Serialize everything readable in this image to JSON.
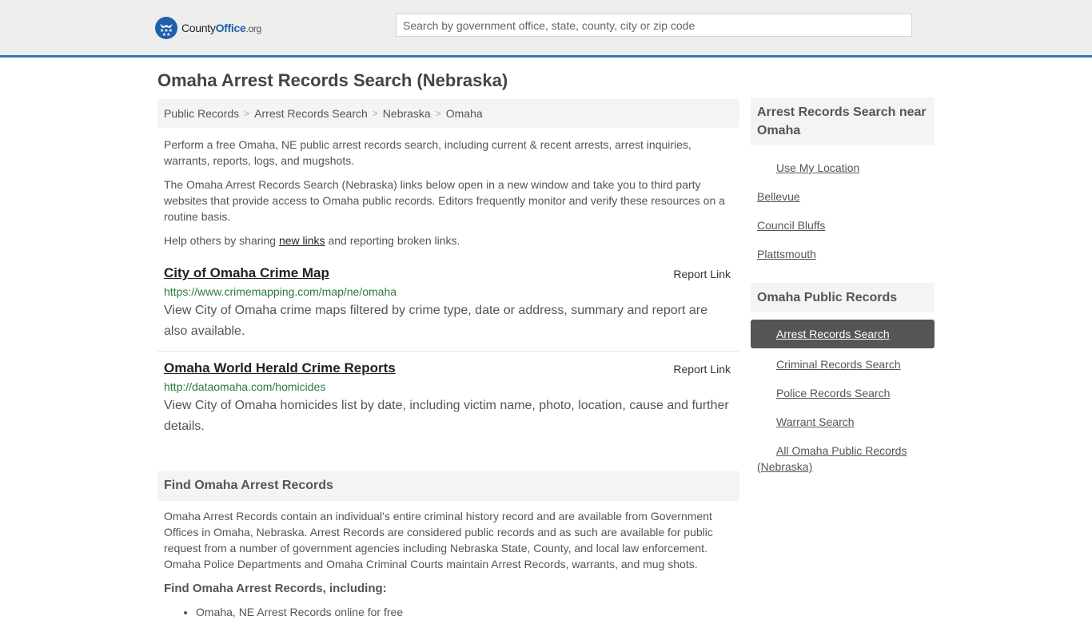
{
  "header": {
    "logo": {
      "name_part1": "County",
      "name_part2": "Office",
      "tld": ".org"
    },
    "search_placeholder": "Search by government office, state, county, city or zip code"
  },
  "page_title": "Omaha Arrest Records Search (Nebraska)",
  "breadcrumb": [
    {
      "label": "Public Records"
    },
    {
      "label": "Arrest Records Search"
    },
    {
      "label": "Nebraska"
    },
    {
      "label": "Omaha"
    }
  ],
  "breadcrumb_separator": ">",
  "intro": {
    "p1": "Perform a free Omaha, NE public arrest records search, including current & recent arrests, arrest inquiries, warrants, reports, logs, and mugshots.",
    "p2": "The Omaha Arrest Records Search (Nebraska) links below open in a new window and take you to third party websites that provide access to Omaha public records. Editors frequently monitor and verify these resources on a routine basis.",
    "p3_before": "Help others by sharing ",
    "p3_link": "new links",
    "p3_after": " and reporting broken links."
  },
  "links": [
    {
      "title": "City of Omaha Crime Map",
      "report_label": "Report Link",
      "url": "https://www.crimemapping.com/map/ne/omaha",
      "description": "View City of Omaha crime maps filtered by crime type, date or address, summary and report are also available."
    },
    {
      "title": "Omaha World Herald Crime Reports",
      "report_label": "Report Link",
      "url": "http://dataomaha.com/homicides",
      "description": "View City of Omaha homicides list by date, including victim name, photo, location, cause and further details."
    }
  ],
  "find_section": {
    "heading": "Find Omaha Arrest Records",
    "body": "Omaha Arrest Records contain an individual's entire criminal history record and are available from Government Offices in Omaha, Nebraska. Arrest Records are considered public records and as such are available for public request from a number of government agencies including Nebraska State, County, and local law enforcement. Omaha Police Departments and Omaha Criminal Courts maintain Arrest Records, warrants, and mug shots.",
    "subheading": "Find Omaha Arrest Records, including:",
    "items": [
      "Omaha, NE Arrest Records online for free"
    ]
  },
  "sidebar": {
    "nearby": {
      "heading": "Arrest Records Search near Omaha",
      "use_location": "Use My Location",
      "cities": [
        "Bellevue",
        "Council Bluffs",
        "Plattsmouth"
      ]
    },
    "public_records": {
      "heading": "Omaha Public Records",
      "items": [
        {
          "label": "Arrest Records Search",
          "active": true
        },
        {
          "label": "Criminal Records Search",
          "active": false
        },
        {
          "label": "Police Records Search",
          "active": false
        },
        {
          "label": "Warrant Search",
          "active": false
        },
        {
          "label": "All Omaha Public Records (Nebraska)",
          "active": false
        }
      ]
    }
  },
  "colors": {
    "brand_blue": "#1f5fa8",
    "header_border": "#337ab7",
    "url_green": "#2c7a36",
    "active_bg": "#555555"
  }
}
